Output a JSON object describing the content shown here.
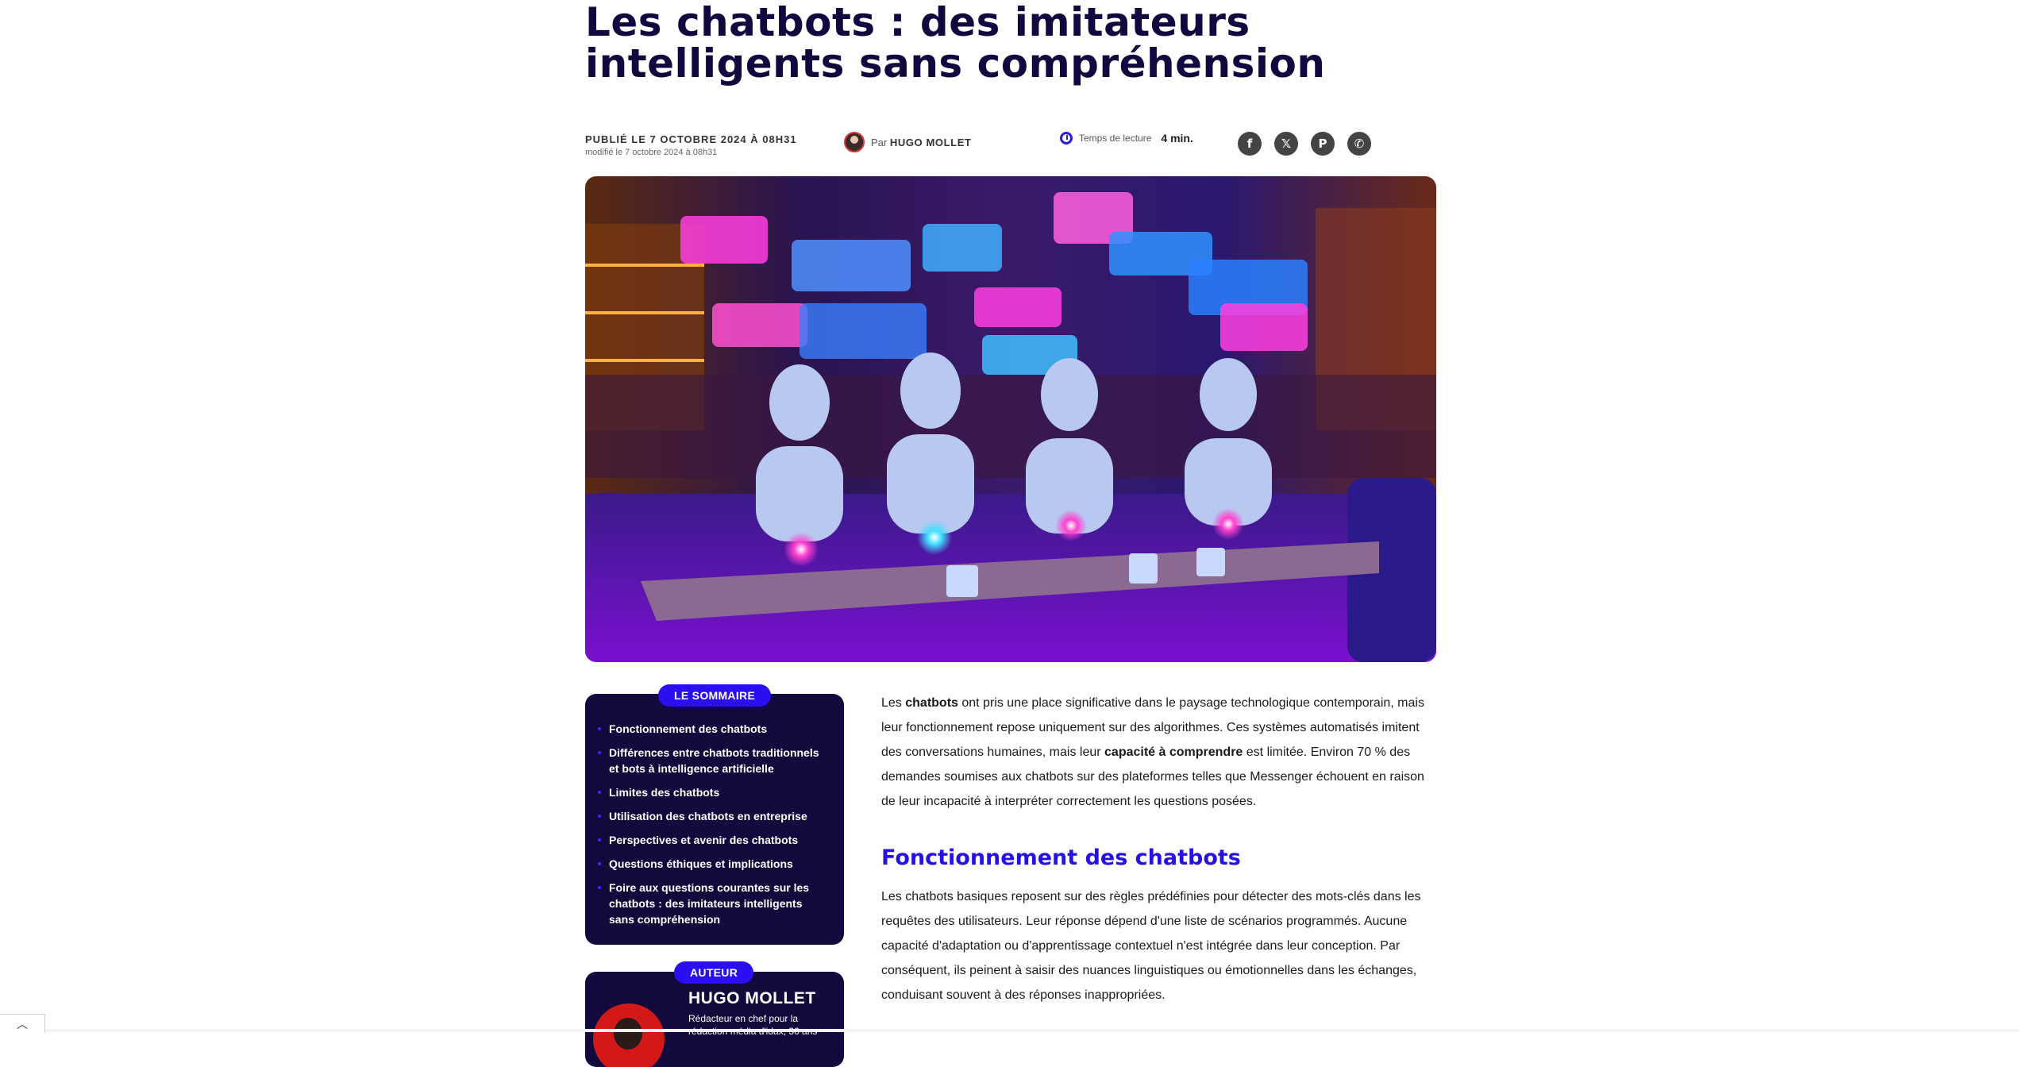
{
  "article": {
    "title": "Les chatbots : des imitateurs intelligents sans compréhension"
  },
  "meta": {
    "published": "PUBLIÉ LE 7 OCTOBRE 2024 À 08H31",
    "modified": "modifié le 7 octobre 2024 à 08h31",
    "by_prefix": "Par",
    "author": "HUGO MOLLET",
    "reading_prefix": "Temps de lecture",
    "reading_time": "4 min."
  },
  "share": [
    {
      "icon": "facebook-icon",
      "glyph": "f"
    },
    {
      "icon": "x-icon",
      "glyph": "𝕏"
    },
    {
      "icon": "pinterest-icon",
      "glyph": "P"
    },
    {
      "icon": "whatsapp-icon",
      "glyph": "✆"
    }
  ],
  "toc": {
    "label": "LE SOMMAIRE",
    "items": [
      "Fonctionnement des chatbots",
      "Différences entre chatbots traditionnels et bots à intelligence artificielle",
      "Limites des chatbots",
      "Utilisation des chatbots en entreprise",
      "Perspectives et avenir des chatbots",
      "Questions éthiques et implications",
      "Foire aux questions courantes sur les chatbots : des imitateurs intelligents sans compréhension"
    ]
  },
  "author_box": {
    "label": "AUTEUR",
    "name": "HUGO MOLLET",
    "role": "Rédacteur en chef pour la rédaction média d'idax, 36 ans"
  },
  "content": {
    "intro_1": "Les ",
    "intro_bold_1": "chatbots",
    "intro_2": " ont pris une place significative dans le paysage technologique contemporain, mais leur fonctionnement repose uniquement sur des algorithmes. Ces systèmes automatisés imitent des conversations humaines, mais leur ",
    "intro_bold_2": "capacité à comprendre",
    "intro_3": " est limitée. Environ 70 % des demandes soumises aux chatbots sur des plateformes telles que Messenger échouent en raison de leur incapacité à interpréter correctement les questions posées.",
    "h2_1": "Fonctionnement des chatbots",
    "p_2": "Les chatbots basiques reposent sur des règles prédéfinies pour détecter des mots-clés dans les requêtes des utilisateurs. Leur réponse dépend d'une liste de scénarios programmés. Aucune capacité d'adaptation ou d'apprentissage contextuel n'est intégrée dans leur conception. Par conséquent, ils peinent à saisir des nuances linguistiques ou émotionnelles dans les échanges, conduisant souvent à des réponses inappropriées."
  },
  "colors": {
    "title": "#10093f",
    "accent": "#2510e6",
    "panel": "#14093c"
  },
  "scroll_icon": "chevron-up-icon"
}
